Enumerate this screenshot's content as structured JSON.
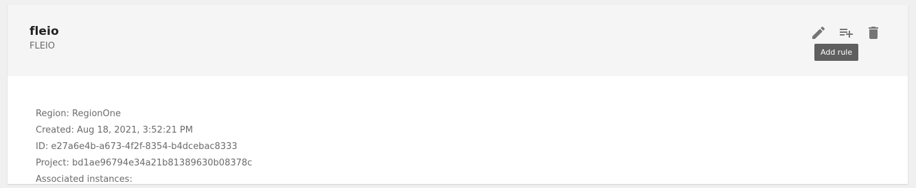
{
  "header": {
    "title": "fleio",
    "subtitle": "FLEIO"
  },
  "actions": {
    "edit_icon": "pencil-icon",
    "add_rule_icon": "playlist-add-icon",
    "delete_icon": "trash-icon",
    "tooltip": "Add rule"
  },
  "details": {
    "region": "Region: RegionOne",
    "created": "Created: Aug 18, 2021, 3:52:21 PM",
    "id": "ID: e27a6e4b-a673-4f2f-8354-b4dcebac8333",
    "project": "Project: bd1ae96794e34a21b81389630b08378c",
    "instances": "Associated instances:"
  },
  "colors": {
    "header_bg": "#f5f5f5",
    "icon": "#757575",
    "tooltip_bg": "#5f5f5f",
    "text_secondary": "#6b6b6b"
  }
}
